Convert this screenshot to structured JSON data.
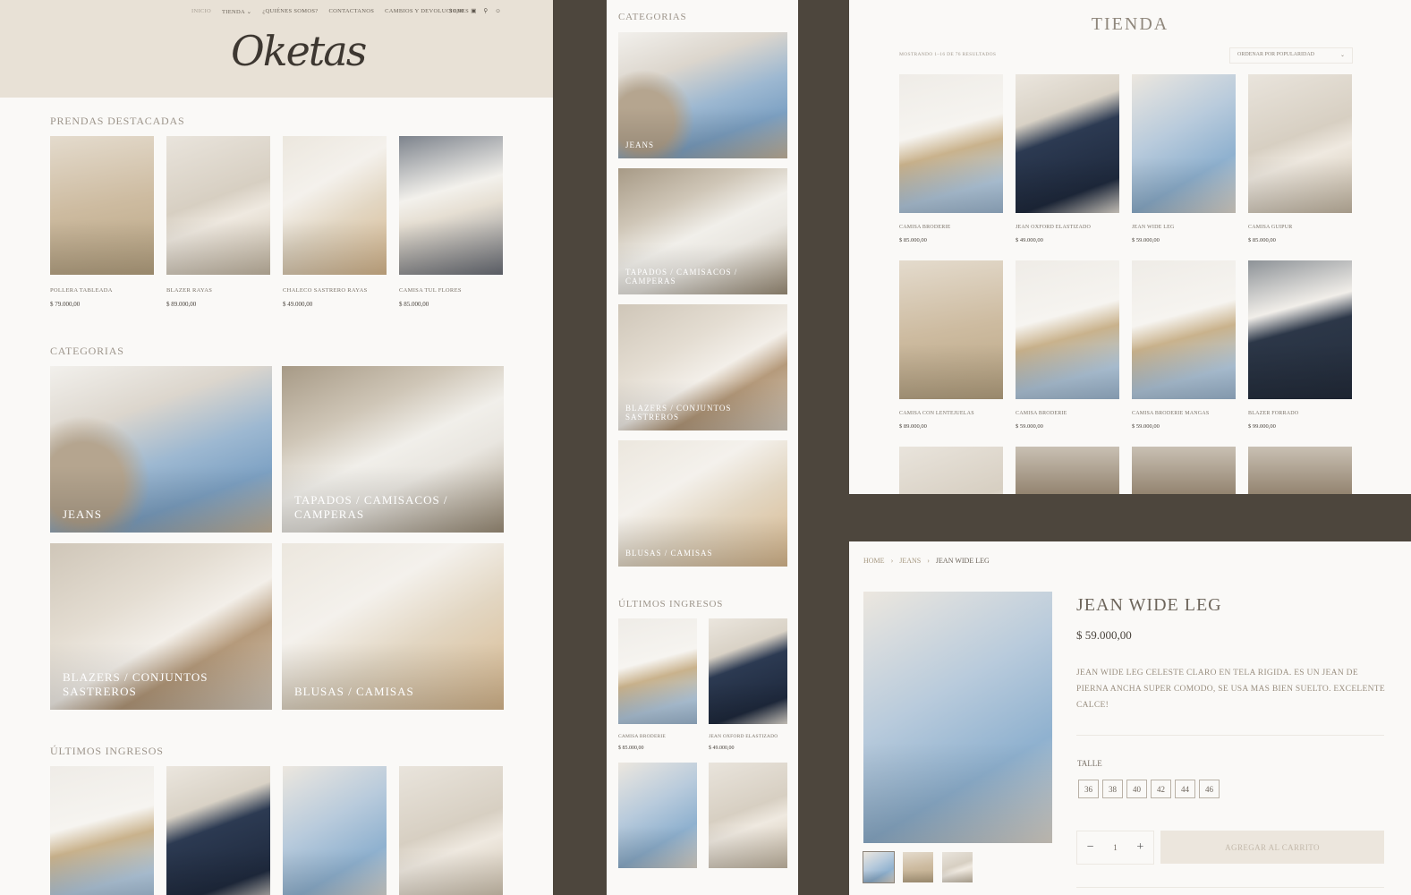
{
  "home": {
    "nav": [
      "INICIO",
      "TIENDA ⌄",
      "¿QUIÉNES SOMOS?",
      "CONTACTANOS",
      "CAMBIOS Y DEVOLUCIONES"
    ],
    "cart_total": "$ 0,00",
    "logo_text": "Oketas",
    "featured_title": "PRENDAS DESTACADAS",
    "featured": [
      {
        "name": "POLLERA TABLEADA",
        "price": "$ 79.000,00"
      },
      {
        "name": "BLAZER RAYAS",
        "price": "$ 89.000,00"
      },
      {
        "name": "CHALECO SASTRERO RAYAS",
        "price": "$ 49.000,00"
      },
      {
        "name": "CAMISA TUL FLORES",
        "price": "$ 85.000,00"
      }
    ],
    "categories_title": "CATEGORIAS",
    "categories": [
      "JEANS",
      "TAPADOS / CAMISACOS / CAMPERAS",
      "BLAZERS / CONJUNTOS SASTREROS",
      "BLUSAS / CAMISAS"
    ],
    "latest_title": "ÚLTIMOS INGRESOS"
  },
  "mobile": {
    "categories_title": "CATEGORIAS",
    "categories": [
      "JEANS",
      "TAPADOS / CAMISACOS / CAMPERAS",
      "BLAZERS / CONJUNTOS SASTREROS",
      "BLUSAS / CAMISAS"
    ],
    "latest_title": "ÚLTIMOS INGRESOS",
    "latest": [
      {
        "name": "CAMISA BRODERIE",
        "price": "$ 85.000,00"
      },
      {
        "name": "JEAN OXFORD ELASTIZADO",
        "price": "$ 49.000,00"
      }
    ]
  },
  "shop": {
    "title": "TIENDA",
    "results": "MOSTRANDO 1–16 DE 76 RESULTADOS",
    "sort": "ORDENAR POR POPULARIDAD",
    "products": [
      {
        "name": "CAMISA BRODERIE",
        "price": "$ 85.000,00"
      },
      {
        "name": "JEAN OXFORD ELASTIZADO",
        "price": "$ 49.000,00"
      },
      {
        "name": "JEAN WIDE LEG",
        "price": "$ 59.000,00"
      },
      {
        "name": "CAMISA GUIPUR",
        "price": "$ 85.000,00"
      },
      {
        "name": "CAMISA CON LENTEJUELAS",
        "price": "$ 89.000,00"
      },
      {
        "name": "CAMISA BRODERIE",
        "price": "$ 59.000,00"
      },
      {
        "name": "CAMISA BRODERIE MANGAS",
        "price": "$ 59.000,00"
      },
      {
        "name": "BLAZER FORRADO",
        "price": "$ 99.000,00"
      }
    ]
  },
  "product": {
    "breadcrumb": [
      "HOME",
      "JEANS",
      "JEAN WIDE LEG"
    ],
    "name": "JEAN WIDE LEG",
    "price": "$ 59.000,00",
    "description": "JEAN WIDE LEG CELESTE CLARO EN TELA RIGIDA. ES UN JEAN DE PIERNA ANCHA SUPER COMODO, SE USA MAS BIEN SUELTO. EXCELENTE CALCE!",
    "size_label": "TALLE",
    "sizes": [
      "36",
      "38",
      "40",
      "42",
      "44",
      "46"
    ],
    "quantity": "1",
    "add_to_cart": "AGREGAR AL CARRITO"
  }
}
